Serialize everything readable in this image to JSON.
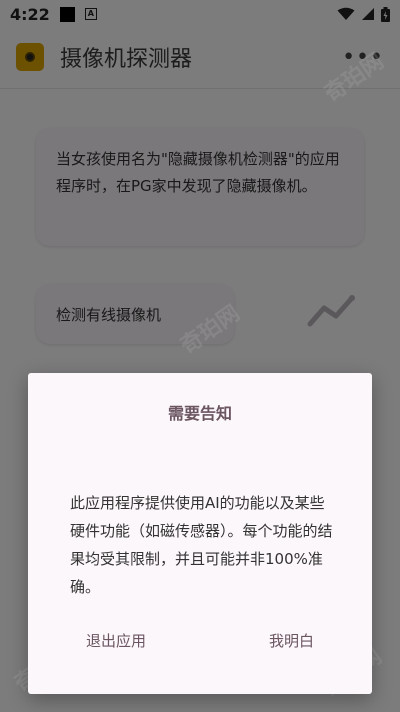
{
  "status_bar": {
    "time": "4:22",
    "notification_badge": "A"
  },
  "app_bar": {
    "title": "摄像机探测器",
    "menu_label": "•••"
  },
  "info_card": {
    "text": "当女孩使用名为\"隐藏摄像机检测器\"的应用程序时，在PG家中发现了隐藏摄像机。"
  },
  "wired_card": {
    "label": "检测有线摄像机"
  },
  "dialog": {
    "title": "需要告知",
    "body": "此应用程序提供使用AI的功能以及某些硬件功能（如磁传感器）。每个功能的结果均受其限制，并且可能并非100%准确。",
    "exit_label": "退出应用",
    "ok_label": "我明白"
  },
  "watermark": {
    "text": "奇珀网"
  },
  "colors": {
    "accent": "#6b5560",
    "logo": "#d7a200",
    "scrim": "rgba(0,0,0,0.5)"
  },
  "icons": [
    "wifi-icon",
    "signal-icon",
    "battery-icon",
    "camera-logo-icon",
    "overflow-menu-icon",
    "trend-chart-icon"
  ]
}
